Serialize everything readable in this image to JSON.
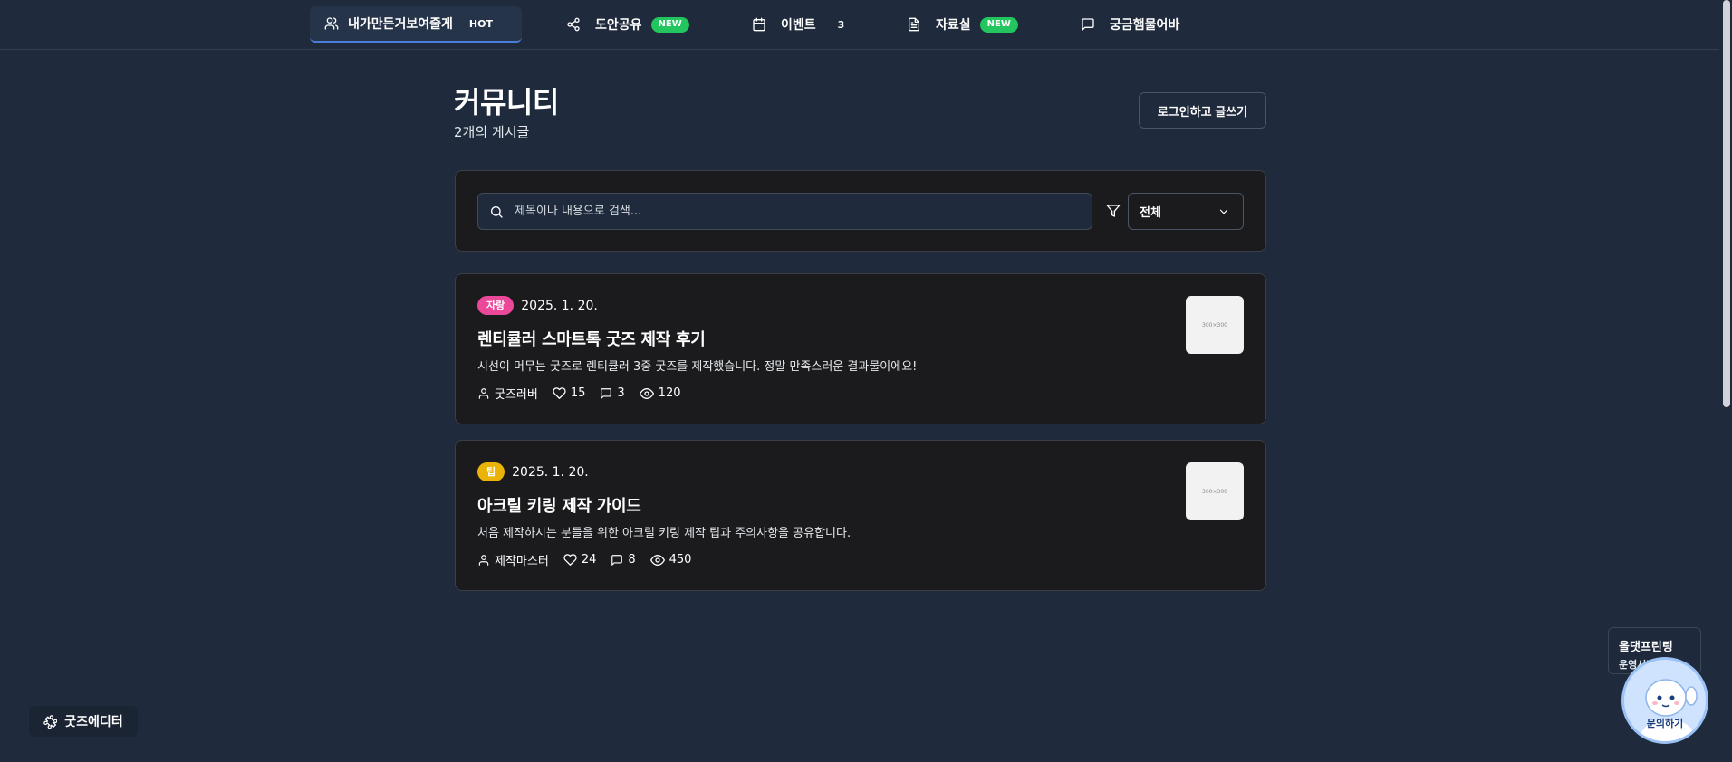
{
  "nav": {
    "items": [
      {
        "label": "내가만든거보여줄게",
        "badge": "HOT",
        "icon": "users-icon"
      },
      {
        "label": "도안공유",
        "badge": "NEW",
        "icon": "share-icon"
      },
      {
        "label": "이벤트",
        "count": "3",
        "icon": "calendar-icon"
      },
      {
        "label": "자료실",
        "badge": "NEW",
        "icon": "file-icon"
      },
      {
        "label": "궁금햄물어바",
        "icon": "message-icon"
      }
    ]
  },
  "header": {
    "title": "커뮤니티",
    "post_count": "2개의 게시글",
    "write_label": "로그인하고 글쓰기"
  },
  "search": {
    "placeholder": "제목이나 내용으로 검색...",
    "filter_value": "전체"
  },
  "posts": [
    {
      "tag": "자랑",
      "tag_color": "#ec4899",
      "date": "2025. 1. 20.",
      "title": "렌티큘러 스마트톡 굿즈 제작 후기",
      "excerpt": "시선이 머무는 굿즈로 렌티큘러 3중 굿즈를 제작했습니다. 정말 만족스러운 결과물이에요!",
      "author": "굿즈러버",
      "likes": "15",
      "comments": "3",
      "views": "120",
      "thumb_text": "300×300"
    },
    {
      "tag": "팁",
      "tag_color": "#eab308",
      "date": "2025. 1. 20.",
      "title": "아크릴 키링 제작 가이드",
      "excerpt": "처음 제작하시는 분들을 위한 아크릴 키링 제작 팁과 주의사항을 공유합니다.",
      "author": "제작마스터",
      "likes": "24",
      "comments": "8",
      "views": "450",
      "thumb_text": "300×300"
    }
  ],
  "floating": {
    "editor_label": "굿즈에디터",
    "hours_name": "올댓프린팅",
    "hours_link": "운영시간 보기 >",
    "inquiry_label": "문의하기"
  },
  "colors": {
    "background": "#1f2a3c",
    "card": "#1b1b1d",
    "new_badge": "#22c55e",
    "active_underline": "#4a7dd8"
  }
}
